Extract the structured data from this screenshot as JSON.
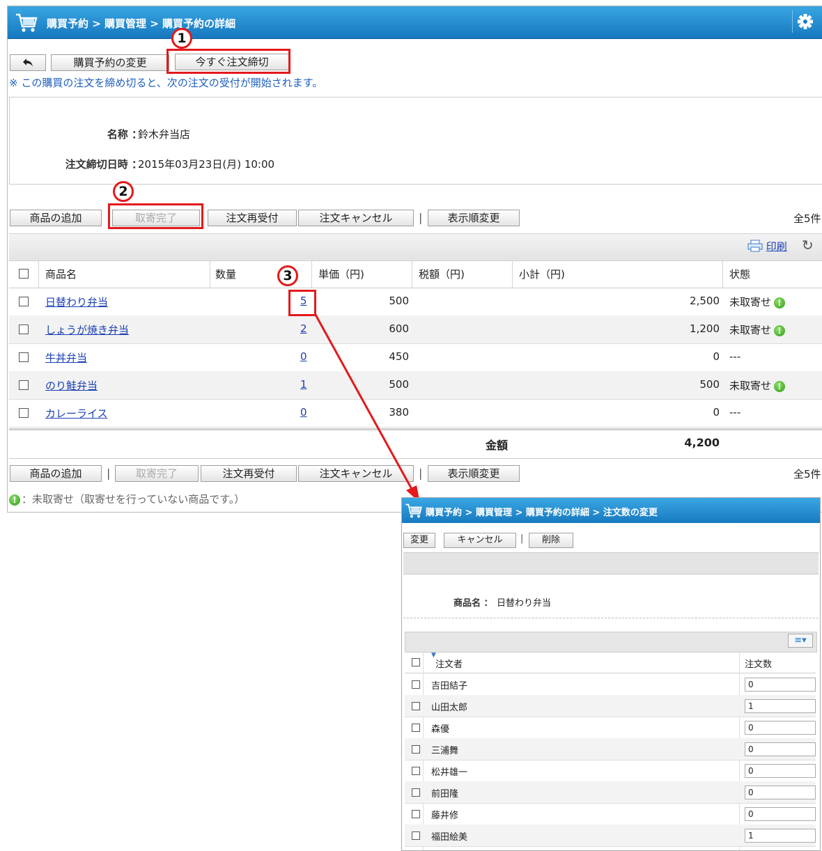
{
  "main": {
    "breadcrumb": "購買予約 > 購買管理 > 購買予約の詳細",
    "toolbar": {
      "back_label": "",
      "edit_label": "購買予約の変更",
      "close_now_label": "今すぐ注文締切"
    },
    "note": "※ この購買の注文を締め切ると、次の注文の受付が開始されます。",
    "info": {
      "name_label": "名称 ：",
      "name_value": "鈴木弁当店",
      "deadline_label": "注文締切日時 ：",
      "deadline_value": "2015年03月23日(月) 10:00"
    },
    "actions": {
      "add": "商品の追加",
      "complete": "取寄完了",
      "reopen": "注文再受付",
      "cancel": "注文キャンセル",
      "sep": "|",
      "reorder": "表示順変更"
    },
    "count": "全5件",
    "print_label": "印刷",
    "columns": [
      "商品名",
      "数量",
      "単価（円)",
      "税額（円)",
      "小計（円)",
      "状態"
    ],
    "rows": [
      {
        "name": "日替わり弁当",
        "qty": "5",
        "price": "500",
        "subtotal": "2,500",
        "status": "未取寄せ",
        "pending": true
      },
      {
        "name": "しょうが焼き弁当",
        "qty": "2",
        "price": "600",
        "subtotal": "1,200",
        "status": "未取寄せ",
        "pending": true
      },
      {
        "name": "牛丼弁当",
        "qty": "0",
        "price": "450",
        "subtotal": "0",
        "status": "---",
        "pending": false
      },
      {
        "name": "のり鮭弁当",
        "qty": "1",
        "price": "500",
        "subtotal": "500",
        "status": "未取寄せ",
        "pending": true
      },
      {
        "name": "カレーライス",
        "qty": "0",
        "price": "380",
        "subtotal": "0",
        "status": "---",
        "pending": false
      }
    ],
    "total_label": "金額",
    "total_value": "4,200",
    "legend": "：未取寄せ（取寄せを行っていない商品です。）"
  },
  "markers": [
    "1",
    "2",
    "3"
  ],
  "popup": {
    "breadcrumb": "購買予約 > 購買管理 > 購買予約の詳細 > 注文数の変更",
    "buttons": {
      "change": "変更",
      "cancel": "キャンセル",
      "sep": "|",
      "delete": "削除"
    },
    "product_label": "商品名 ：",
    "product_value": "日替わり弁当",
    "columns": {
      "orderer": "注文者",
      "qty": "注文数"
    },
    "rows": [
      {
        "name": "吉田結子",
        "qty": "0"
      },
      {
        "name": "山田太郎",
        "qty": "1"
      },
      {
        "name": "森優",
        "qty": "0"
      },
      {
        "name": "三浦舞",
        "qty": "0"
      },
      {
        "name": "松井雄一",
        "qty": "0"
      },
      {
        "name": "前田隆",
        "qty": "0"
      },
      {
        "name": "藤井修",
        "qty": "0"
      },
      {
        "name": "福田絵美",
        "qty": "1"
      }
    ]
  },
  "colors": {
    "title_blue": "#1f7fc9",
    "annotation_red": "#e3191b",
    "link_blue": "#1a3fb3"
  },
  "icons": [
    "cart-icon",
    "gear-icon",
    "back-arrow-icon",
    "printer-icon",
    "refresh-icon",
    "status-ok-icon",
    "list-menu-icon"
  ]
}
